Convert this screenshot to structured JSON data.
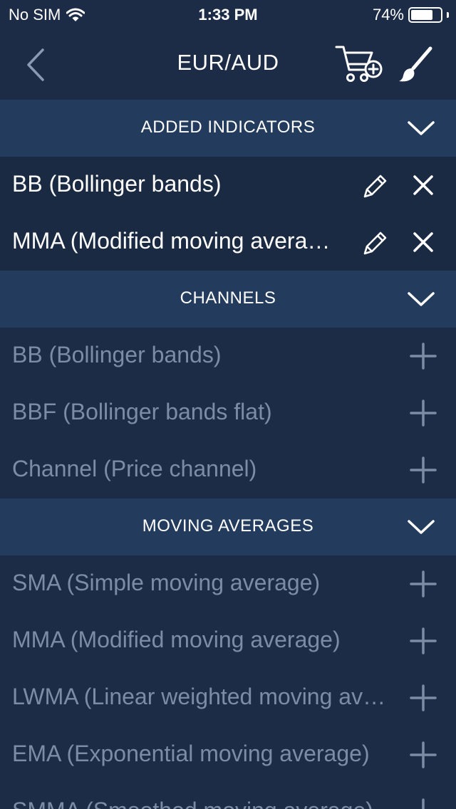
{
  "status_bar": {
    "carrier": "No SIM",
    "time": "1:33 PM",
    "battery_percent": "74%",
    "battery_level": 0.74
  },
  "nav": {
    "title": "EUR/AUD",
    "back_icon": "chevron-left-icon",
    "cart_icon": "cart-add-icon",
    "brush_icon": "brush-icon"
  },
  "sections": [
    {
      "title": "ADDED INDICATORS",
      "items": [
        {
          "label": "BB (Bollinger bands)"
        },
        {
          "label": "MMA (Modified moving average)"
        }
      ]
    },
    {
      "title": "CHANNELS",
      "items": [
        {
          "label": "BB (Bollinger bands)"
        },
        {
          "label": "BBF (Bollinger bands flat)"
        },
        {
          "label": "Channel (Price channel)"
        }
      ]
    },
    {
      "title": "MOVING AVERAGES",
      "items": [
        {
          "label": "SMA (Simple moving average)"
        },
        {
          "label": "MMA (Modified moving average)"
        },
        {
          "label": "LWMA (Linear weighted moving average)"
        },
        {
          "label": "EMA (Exponential moving average)"
        },
        {
          "label": "SMMA (Smoothed moving average)"
        }
      ]
    }
  ],
  "colors": {
    "background": "#1c2c47",
    "section_header": "#233c5e",
    "added_row": "#1b2a43",
    "muted_text": "#7d8ca4",
    "white": "#ffffff"
  }
}
